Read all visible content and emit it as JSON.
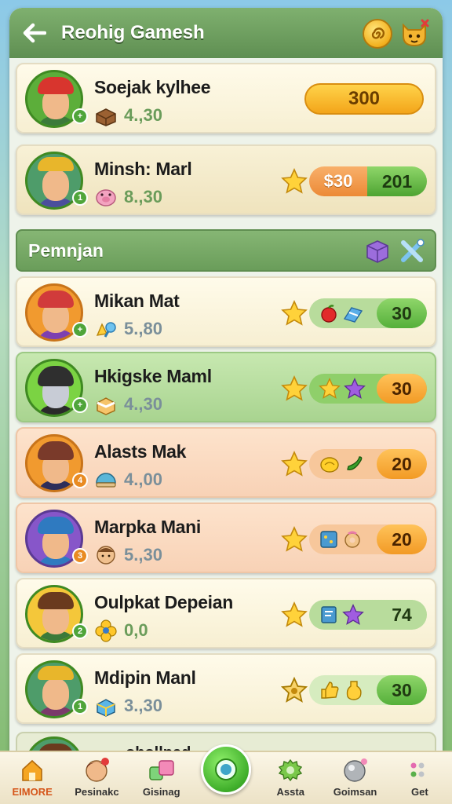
{
  "header": {
    "title": "Reohig Gamesh"
  },
  "players": [
    {
      "name": "Soejak kylhee",
      "score": "4.,30",
      "level": "+",
      "reward_value": "300"
    },
    {
      "name": "Minsh: Marl",
      "score": "8.,30",
      "level": "1",
      "left_value": "$30",
      "right_value": "201"
    }
  ],
  "section": {
    "title": "Pemnjan"
  },
  "section_players": [
    {
      "name": "Mikan Mat",
      "score": "5.,80",
      "level": "+",
      "value": "30"
    },
    {
      "name": "Hkigske Maml",
      "score": "4.,30",
      "level": "+",
      "value": "30"
    },
    {
      "name": "Alasts Mak",
      "score": "4.,00",
      "level": "4",
      "value": "20"
    },
    {
      "name": "Marpka Mani",
      "score": "5.,30",
      "level": "3",
      "value": "20"
    },
    {
      "name": "Oulpkat Depeian",
      "score": "0,0",
      "level": "2",
      "value": "74"
    },
    {
      "name": "Mdipin Manl",
      "score": "3.,30",
      "level": "1",
      "value": "30"
    }
  ],
  "partial_player": {
    "name": "ohollpad"
  },
  "bottom_nav": [
    {
      "label": "EIMORE",
      "icon": "home-icon"
    },
    {
      "label": "Pesinakc",
      "icon": "avatar-icon"
    },
    {
      "label": "Gisinag",
      "icon": "blocks-icon"
    },
    {
      "label": "",
      "icon": "play-icon"
    },
    {
      "label": "Assta",
      "icon": "gear-icon"
    },
    {
      "label": "Goimsan",
      "icon": "sphere-icon"
    },
    {
      "label": "Get",
      "icon": "dots-icon"
    }
  ],
  "colors": {
    "header_green": "#6a9d5a",
    "accent_orange": "#f29a25",
    "accent_green": "#55b03a",
    "active_nav": "#d5561a"
  }
}
